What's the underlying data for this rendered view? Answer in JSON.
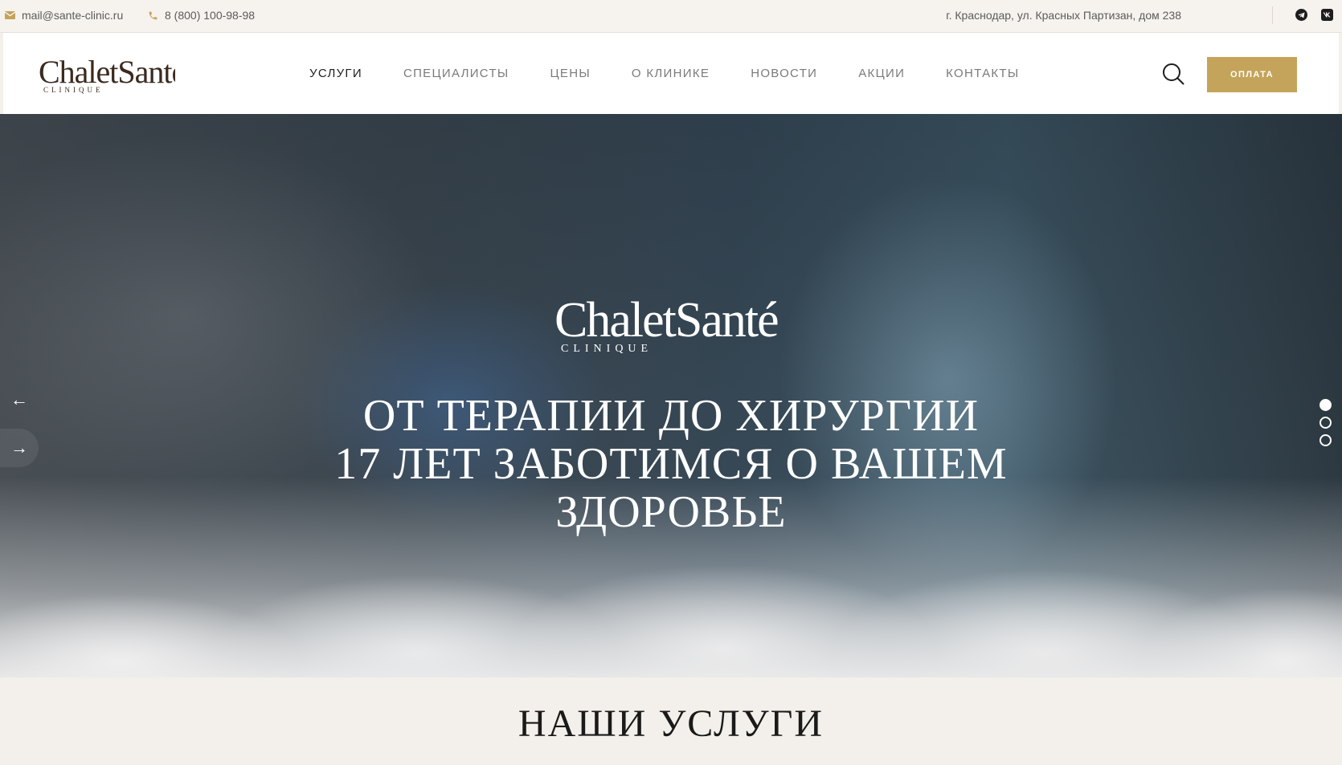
{
  "topbar": {
    "email": "mail@sante-clinic.ru",
    "phone": "8 (800) 100-98-98",
    "address": "г. Краснодар, ул. Красных Партизан, дом 238",
    "social": [
      "telegram-icon",
      "vk-icon"
    ],
    "icon_color": "#c4a45a"
  },
  "header": {
    "logo_main": "ChaletSanté",
    "logo_sub": "CLINIQUE",
    "nav": [
      {
        "label": "УСЛУГИ",
        "active": true
      },
      {
        "label": "СПЕЦИАЛИСТЫ",
        "active": false
      },
      {
        "label": "ЦЕНЫ",
        "active": false
      },
      {
        "label": "О КЛИНИКЕ",
        "active": false
      },
      {
        "label": "НОВОСТИ",
        "active": false
      },
      {
        "label": "АКЦИИ",
        "active": false
      },
      {
        "label": "КОНТАКТЫ",
        "active": false
      }
    ],
    "pay_label": "ОПЛАТА",
    "accent_color": "#c4a45a"
  },
  "hero": {
    "logo_main": "ChaletSanté",
    "logo_sub": "CLINIQUE",
    "title_line1": "ОТ ТЕРАПИИ ДО ХИРУРГИИ",
    "title_line2": "17 ЛЕТ ЗАБОТИМСЯ О ВАШЕМ",
    "title_line3": "ЗДОРОВЬЕ",
    "prev_arrow": "←",
    "next_arrow": "→",
    "slides_total": 3,
    "slide_active": 1
  },
  "services": {
    "heading": "НАШИ УСЛУГИ"
  }
}
